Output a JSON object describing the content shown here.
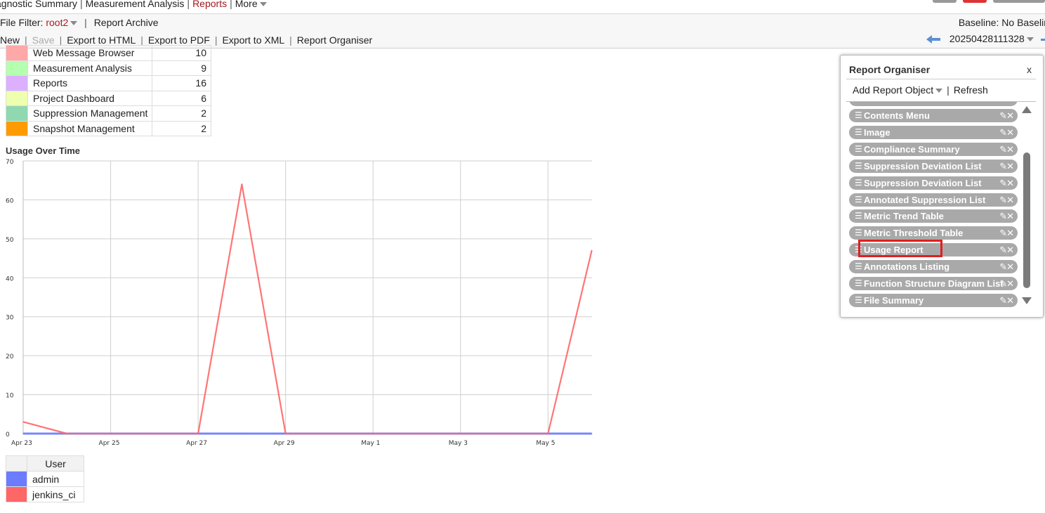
{
  "topnav": {
    "items": [
      "agnostic Summary",
      "Measurement Analysis",
      "Reports",
      "More"
    ],
    "active": "Reports"
  },
  "filterbar": {
    "file_filter_label": "File Filter:",
    "file_filter_value": "root2",
    "report_archive": "Report Archive",
    "baseline": "Baseline: No Baselin"
  },
  "toolbar": {
    "new": "New",
    "save": "Save",
    "export_html": "Export to HTML",
    "export_pdf": "Export to PDF",
    "export_xml": "Export to XML",
    "report_organiser": "Report Organiser",
    "snapshot": "20250428111328"
  },
  "categories": [
    {
      "name": "Web Message Browser",
      "count": "10",
      "color": "#ffa8a8"
    },
    {
      "name": "Measurement Analysis",
      "count": "9",
      "color": "#b5ffb0"
    },
    {
      "name": "Reports",
      "count": "16",
      "color": "#dcb0ff"
    },
    {
      "name": "Project Dashboard",
      "count": "6",
      "color": "#eeffb0"
    },
    {
      "name": "Suppression Management",
      "count": "2",
      "color": "#8fd8b0"
    },
    {
      "name": "Snapshot Management",
      "count": "2",
      "color": "#ff9a00"
    }
  ],
  "chart_data": {
    "type": "line",
    "title": "Usage Over Time",
    "ylim": [
      0,
      70
    ],
    "yticks": [
      0,
      10,
      20,
      30,
      40,
      50,
      60,
      70
    ],
    "x_tick_labels": [
      "Apr 23",
      "Apr 25",
      "Apr 27",
      "Apr 29",
      "May 1",
      "May 3",
      "May 5"
    ],
    "xlim_days": [
      0,
      13.0
    ],
    "grid": true,
    "series": [
      {
        "name": "admin",
        "color": "#6b7cff",
        "x": [
          0,
          1,
          2,
          3,
          4,
          5,
          6,
          7,
          8,
          9,
          10,
          11,
          12,
          13
        ],
        "y": [
          0,
          0,
          0,
          0,
          0,
          0,
          0,
          0,
          0,
          0,
          0,
          0,
          0,
          0
        ]
      },
      {
        "name": "jenkins_ci",
        "color": "#ff6666",
        "x": [
          0,
          1,
          2,
          3,
          4,
          5,
          6,
          7,
          8,
          9,
          10,
          11,
          12,
          13
        ],
        "y": [
          3,
          0,
          0,
          0,
          0,
          64,
          0,
          0,
          0,
          0,
          0,
          0,
          0,
          47
        ]
      }
    ]
  },
  "legend": {
    "header": "User",
    "items": [
      {
        "name": "admin",
        "color": "#6b7cff"
      },
      {
        "name": "jenkins_ci",
        "color": "#ff6666"
      }
    ]
  },
  "organiser": {
    "title": "Report Organiser",
    "close": "x",
    "add_report_object": "Add Report Object",
    "refresh": "Refresh",
    "items": [
      "Contents Menu",
      "Image",
      "Compliance Summary",
      "Suppression Deviation List",
      "Suppression Deviation List",
      "Annotated Suppression List",
      "Metric Trend Table",
      "Metric Threshold Table",
      "Usage Report",
      "Annotations Listing",
      "Function Structure Diagram List",
      "File Summary"
    ],
    "drag_glyph": "☰",
    "tools_glyph": "✎✕",
    "highlighted": "Usage Report"
  }
}
